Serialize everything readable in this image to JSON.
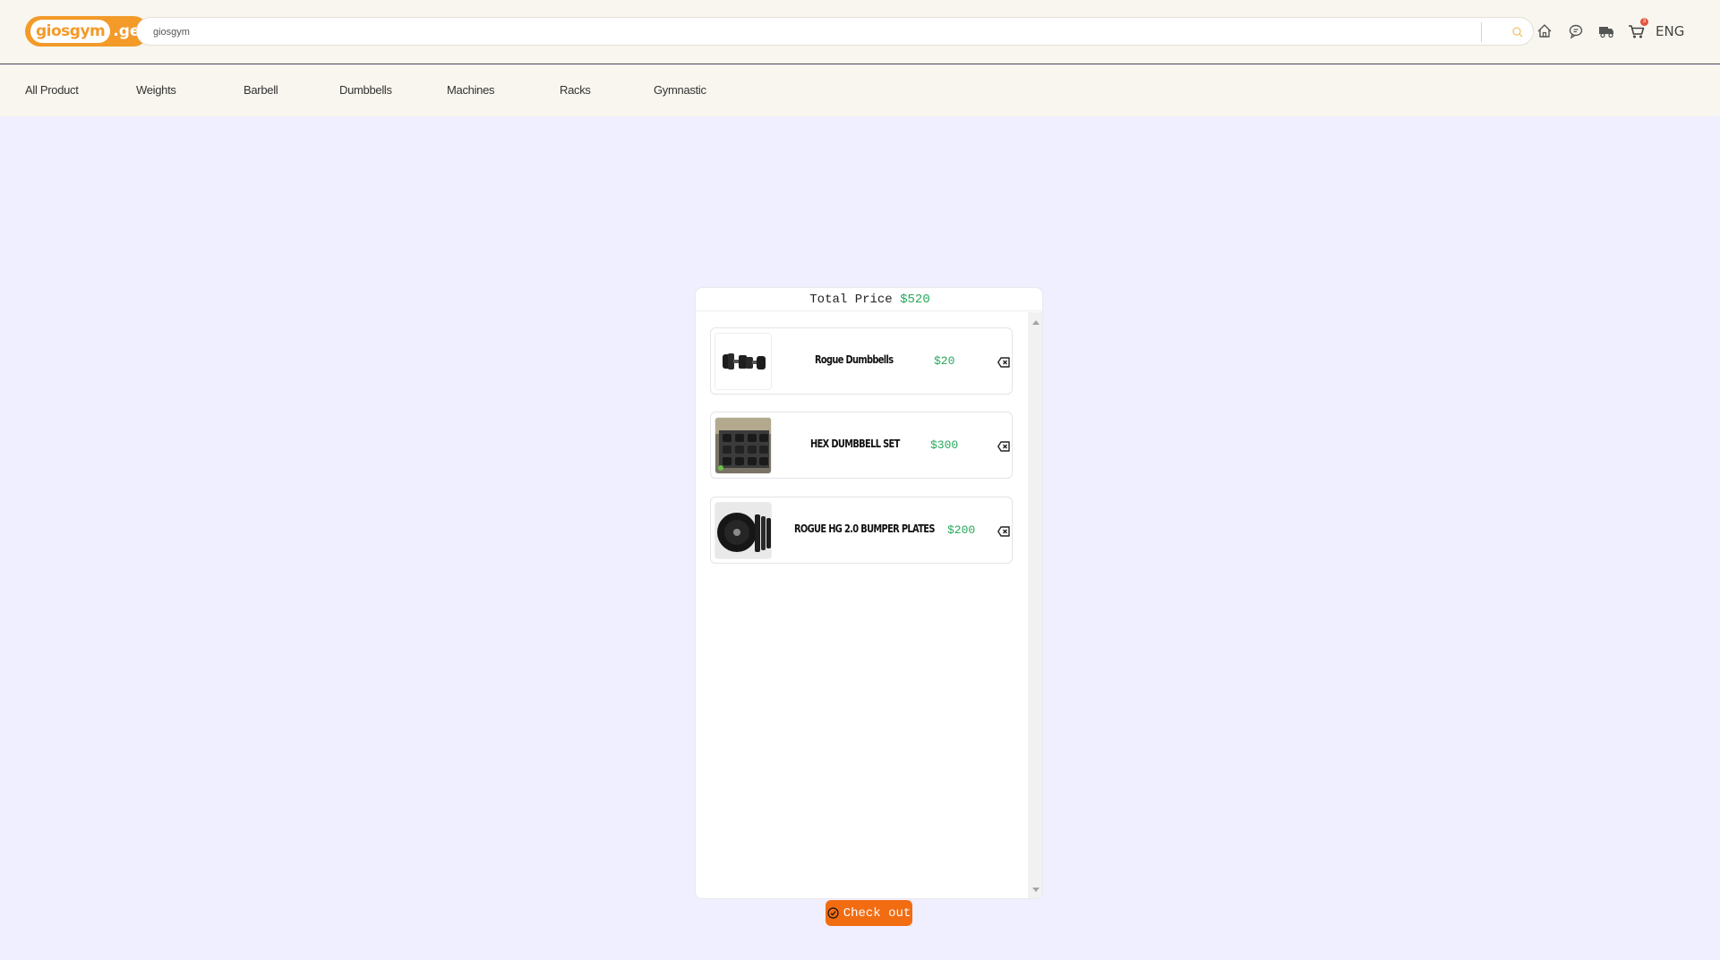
{
  "header": {
    "logo": {
      "name": "giosgym",
      "tld": ".ge"
    },
    "search": {
      "value": "giosgym",
      "placeholder": ""
    },
    "icons": [
      "home-icon",
      "chat-icon",
      "delivery-truck-icon",
      "cart-icon"
    ],
    "cart_count": "3",
    "language": "ENG"
  },
  "nav": {
    "items": [
      "All Product",
      "Weights",
      "Barbell",
      "Dumbbells",
      "Machines",
      "Racks",
      "Gymnastic"
    ]
  },
  "cart": {
    "total_label": "Total Price",
    "total_value": "$520",
    "items": [
      {
        "name": "Rogue Dumbbells",
        "price": "$20",
        "image": "dumbbells-photo"
      },
      {
        "name": "HEX DUMBBELL SET",
        "price": "$300",
        "image": "hex-dumbbell-set-photo"
      },
      {
        "name": "ROGUE HG 2.0 BUMPER PLATES",
        "price": "$200",
        "image": "bumper-plates-photo"
      }
    ],
    "checkout_label": "Check out"
  },
  "colors": {
    "accent": "#f26c12",
    "logo": "#f39a29",
    "price": "#27a85a",
    "background": "#f0efff",
    "header_bg": "#f8f6ee"
  }
}
